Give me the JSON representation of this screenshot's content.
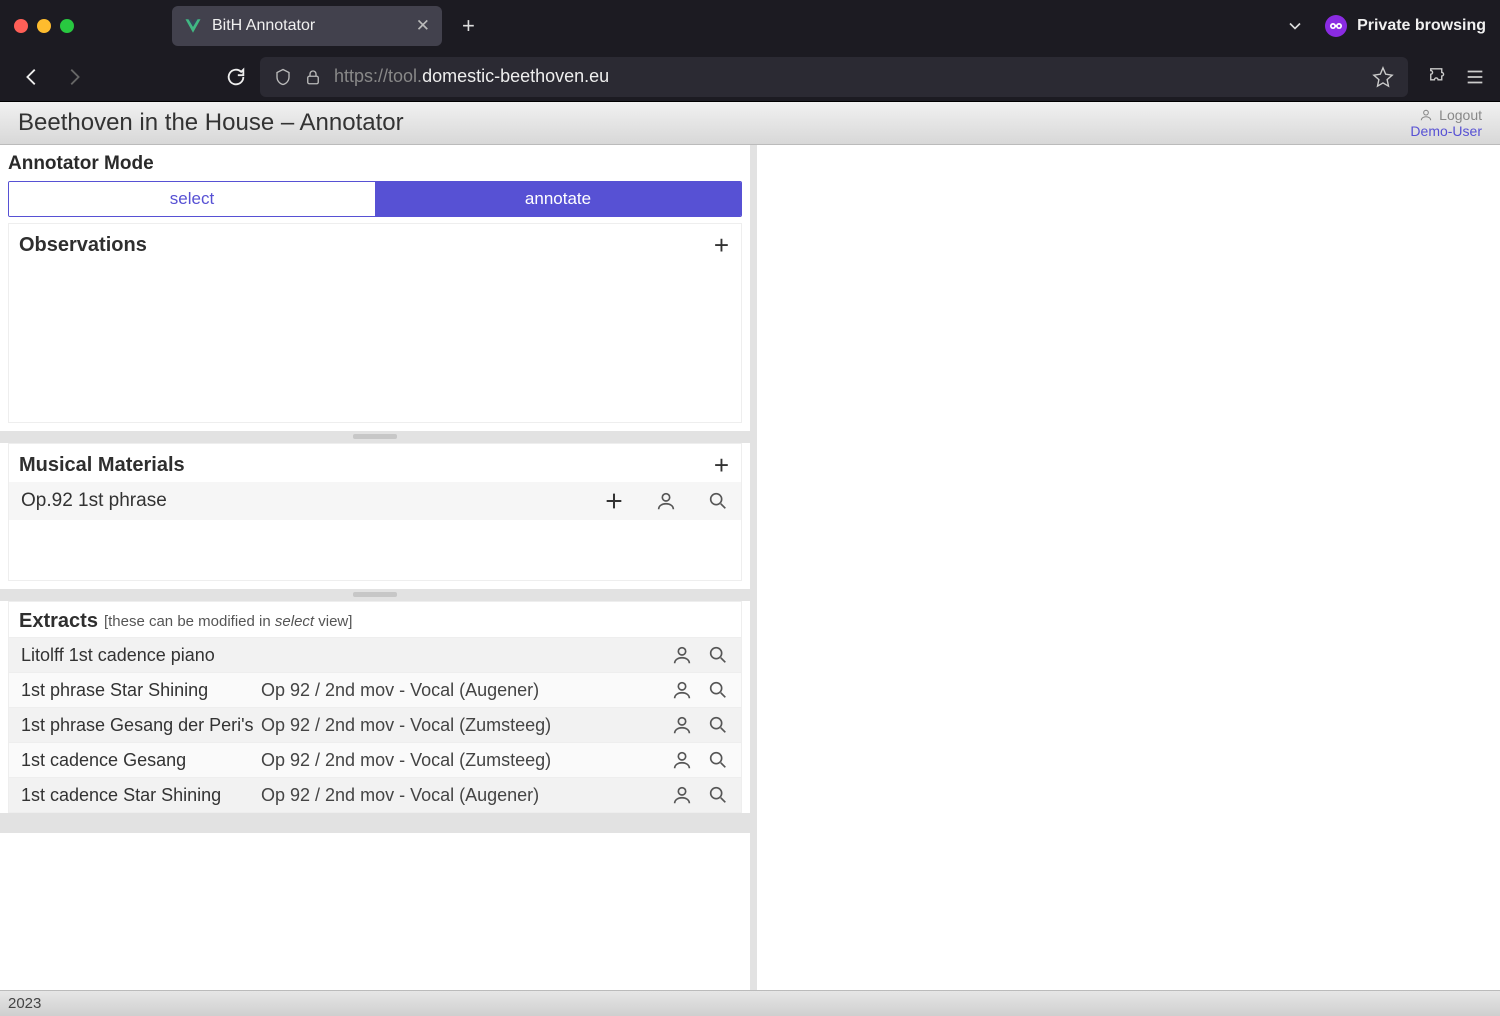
{
  "browser": {
    "tab_title": "BitH Annotator",
    "private_label": "Private browsing",
    "url_prefix": "https://tool.",
    "url_host": "domestic-beethoven.eu"
  },
  "header": {
    "title": "Beethoven in the House – Annotator",
    "logout": "Logout",
    "user": "Demo-User"
  },
  "mode": {
    "label": "Annotator Mode",
    "select": "select",
    "annotate": "annotate"
  },
  "observations": {
    "title": "Observations"
  },
  "materials": {
    "title": "Musical Materials",
    "items": [
      {
        "name": "Op.92 1st phrase"
      }
    ]
  },
  "extracts": {
    "title": "Extracts",
    "note_pre": "[these can be modified in ",
    "note_it": "select",
    "note_post": " view]",
    "items": [
      {
        "name": "Litolff 1st cadence piano",
        "detail": ""
      },
      {
        "name": "1st phrase Star Shining",
        "detail": "Op 92 / 2nd mov - Vocal (Augener)"
      },
      {
        "name": "1st phrase Gesang der Peri's",
        "detail": "Op 92 / 2nd mov - Vocal (Zumsteeg)"
      },
      {
        "name": "1st cadence Gesang",
        "detail": "Op 92 / 2nd mov - Vocal (Zumsteeg)"
      },
      {
        "name": "1st cadence Star Shining",
        "detail": "Op 92 / 2nd mov - Vocal (Augener)"
      }
    ]
  },
  "footer": {
    "year": "2023"
  }
}
